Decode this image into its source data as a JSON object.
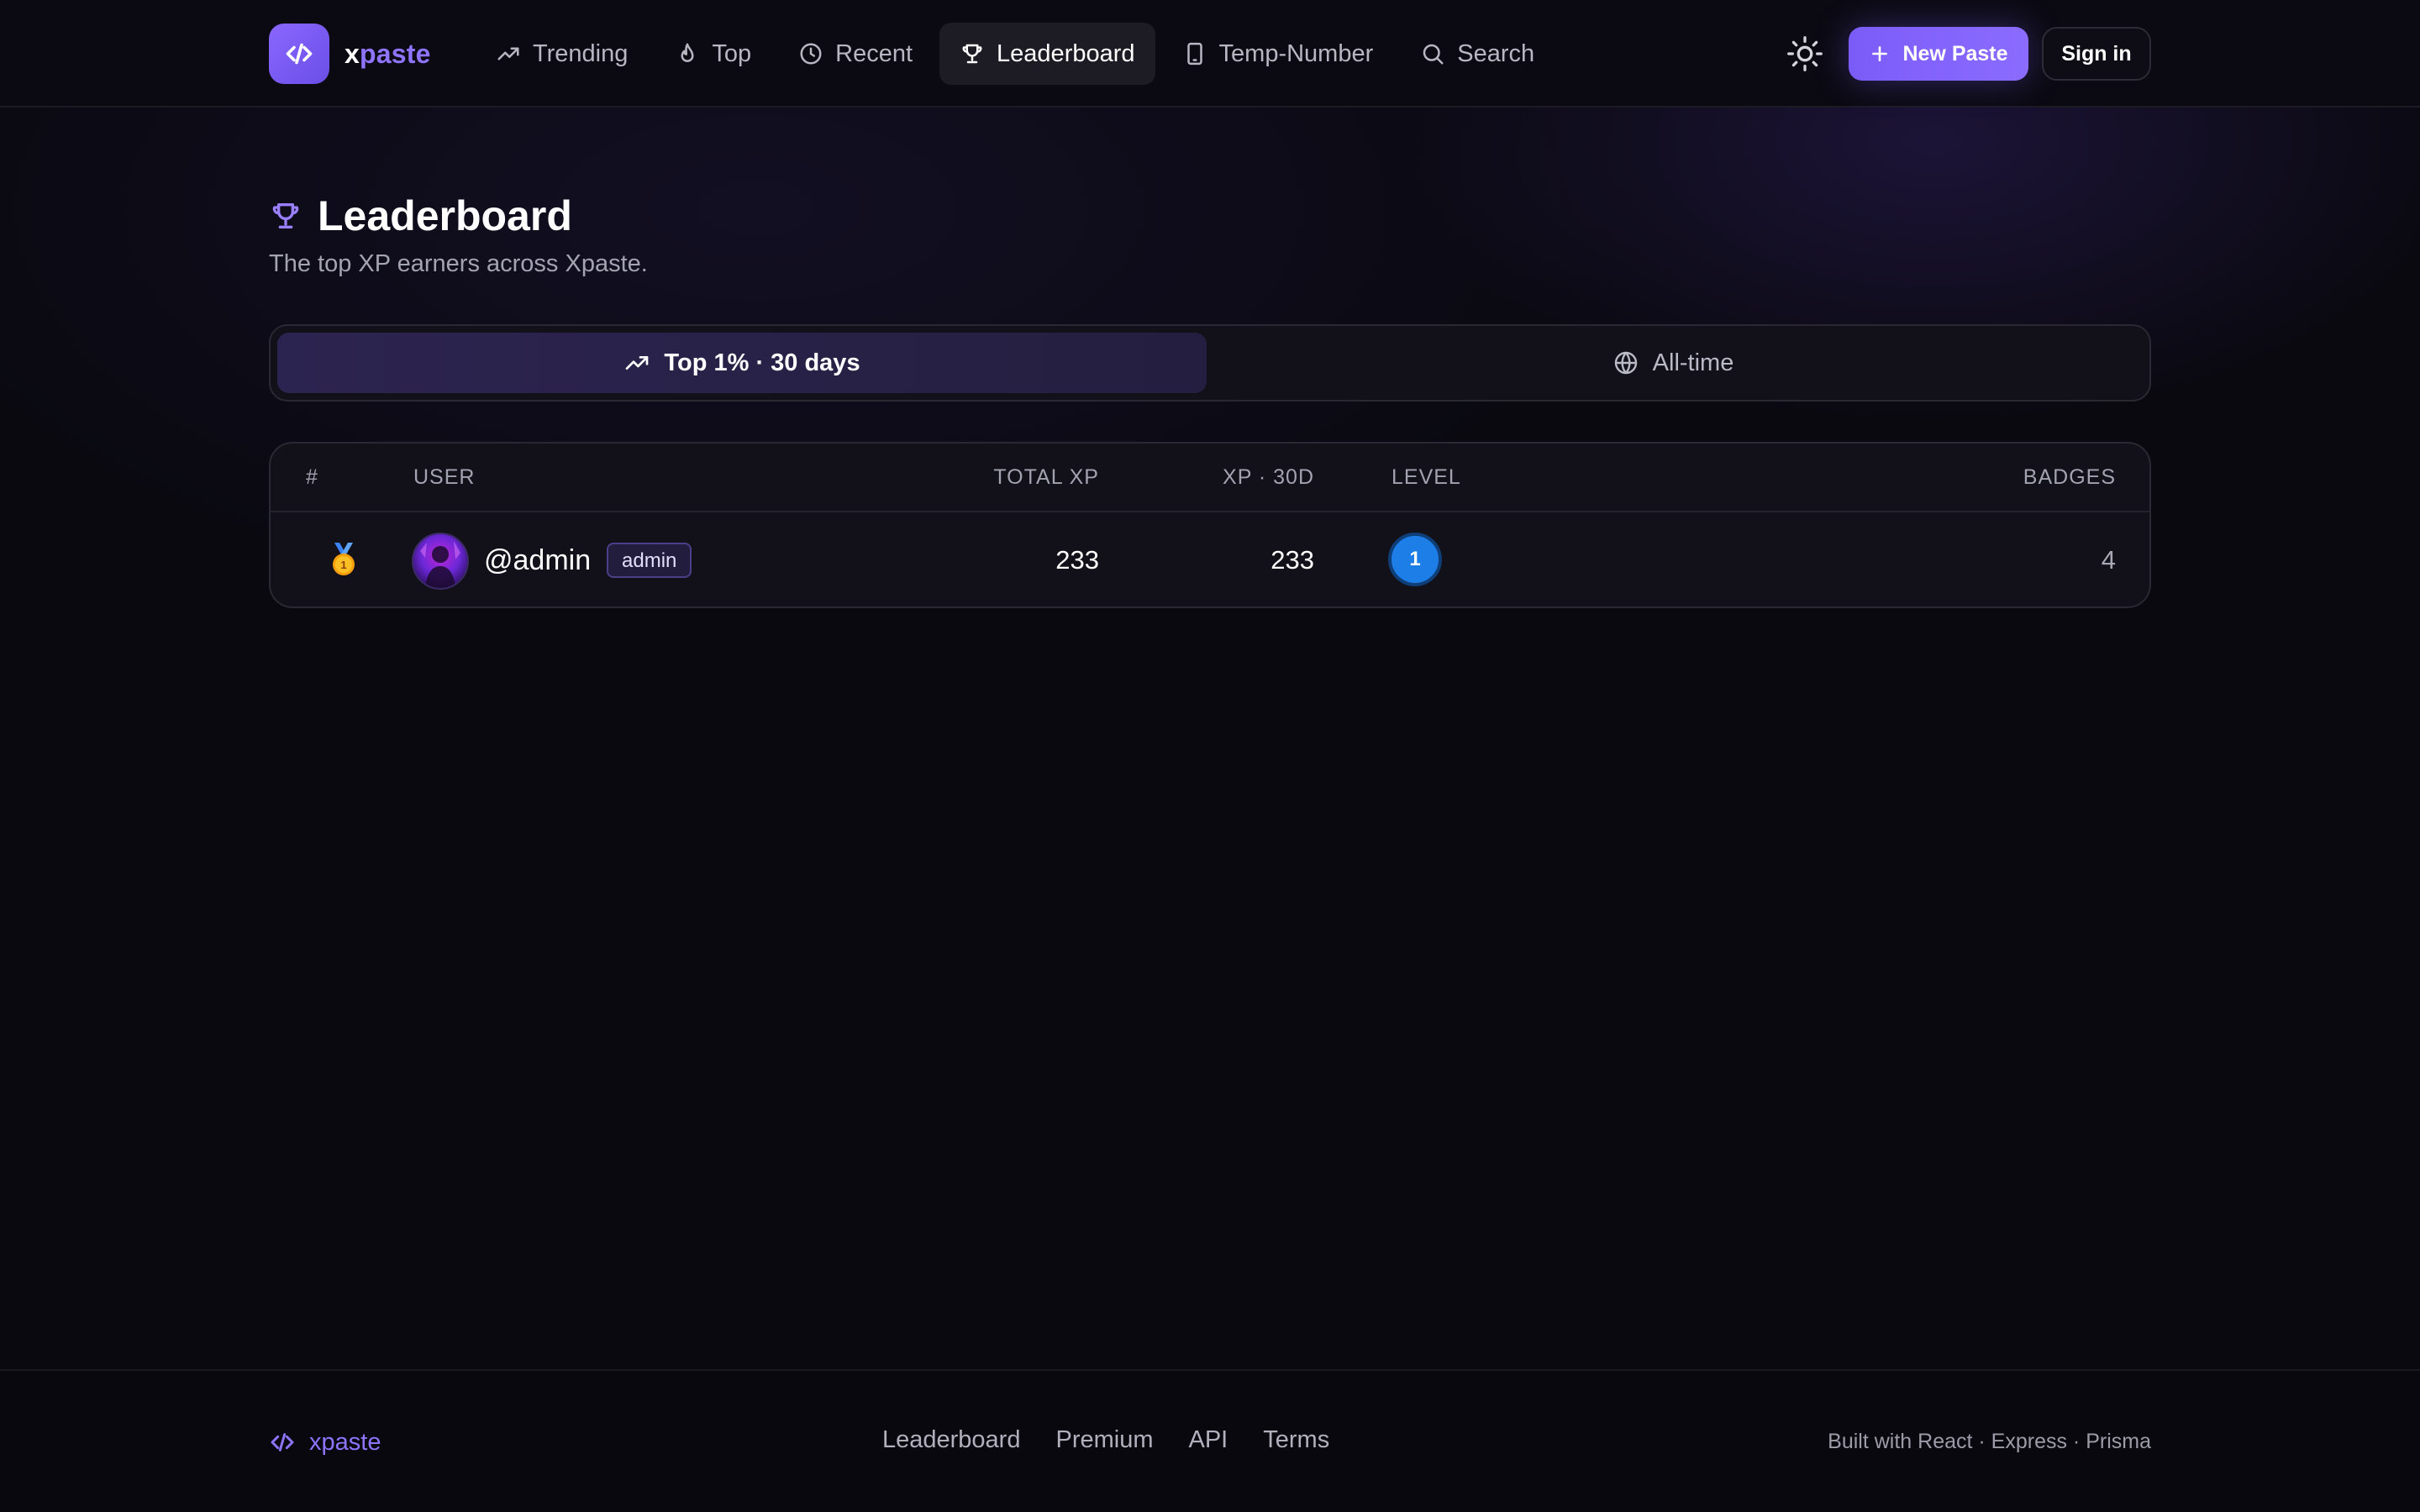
{
  "header": {
    "logo_x": "x",
    "logo_rest": "paste",
    "nav": [
      {
        "label": "Trending",
        "icon": "trending-up-icon"
      },
      {
        "label": "Top",
        "icon": "flame-icon"
      },
      {
        "label": "Recent",
        "icon": "clock-icon"
      },
      {
        "label": "Leaderboard",
        "icon": "trophy-icon",
        "active": true
      },
      {
        "label": "Temp-Number",
        "icon": "phone-icon"
      },
      {
        "label": "Search",
        "icon": "search-icon"
      }
    ],
    "new_paste_label": "New Paste",
    "sign_in_label": "Sign in"
  },
  "page": {
    "title": "Leaderboard",
    "subtitle": "The top XP earners across Xpaste."
  },
  "tabs": [
    {
      "label": "Top 1% · 30 days",
      "icon": "trending-up-icon",
      "active": true
    },
    {
      "label": "All-time",
      "icon": "globe-icon",
      "active": false
    }
  ],
  "table": {
    "columns": {
      "rank": "#",
      "user": "USER",
      "level": "LEVEL",
      "total_xp": "TOTAL XP",
      "xp_30d": "XP · 30D",
      "badges": "BADGES"
    },
    "rows": [
      {
        "rank_medal": "1",
        "username": "@admin",
        "role": "admin",
        "level": "1",
        "total_xp": "233",
        "xp_30d": "233",
        "badges": "4"
      }
    ]
  },
  "footer": {
    "logo_text": "xpaste",
    "links": [
      "Leaderboard",
      "Premium",
      "API",
      "Terms"
    ],
    "built_with": "Built with React · Express · Prisma"
  },
  "colors": {
    "accent": "#8b6cff",
    "background": "#0a0910",
    "level_badge": "#1e7ee8"
  }
}
